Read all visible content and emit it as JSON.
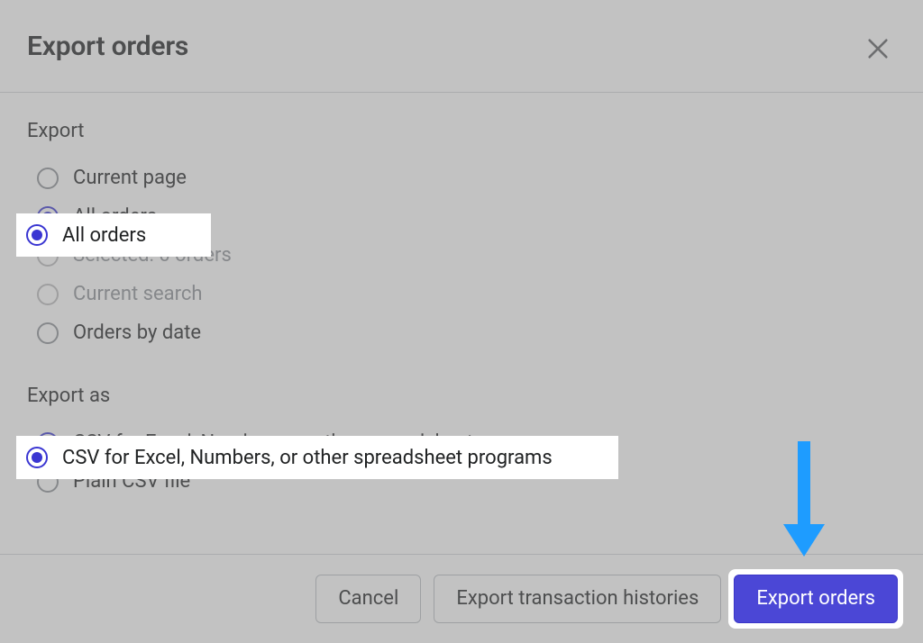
{
  "modal": {
    "title": "Export orders",
    "sections": {
      "export": {
        "label": "Export",
        "options": [
          {
            "label": "Current page",
            "selected": false,
            "disabled": false
          },
          {
            "label": "All orders",
            "selected": true,
            "disabled": false
          },
          {
            "label": "Selected: 0 orders",
            "selected": false,
            "disabled": true
          },
          {
            "label": "Current search",
            "selected": false,
            "disabled": true
          },
          {
            "label": "Orders by date",
            "selected": false,
            "disabled": false
          }
        ]
      },
      "exportAs": {
        "label": "Export as",
        "options": [
          {
            "label": "CSV for Excel, Numbers, or other spreadsheet programs",
            "selected": true,
            "disabled": false
          },
          {
            "label": "Plain CSV file",
            "selected": false,
            "disabled": false
          }
        ]
      }
    },
    "footer": {
      "cancel": "Cancel",
      "exportHistories": "Export transaction histories",
      "exportOrders": "Export orders"
    }
  }
}
